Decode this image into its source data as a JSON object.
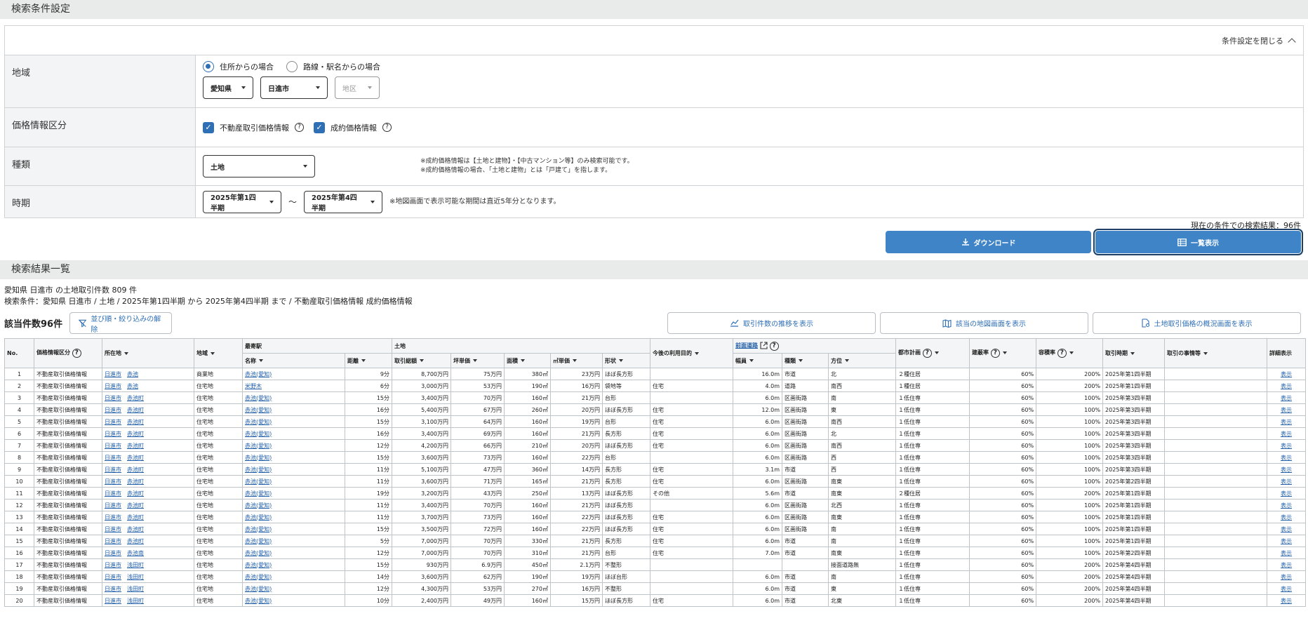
{
  "search_section": {
    "title": "検索条件設定",
    "toggle_label": "条件設定を閉じる"
  },
  "area": {
    "label": "地域",
    "radio_address": "住所からの場合",
    "radio_station": "路線・駅名からの場合",
    "prefecture": "愛知県",
    "city": "日進市",
    "district_placeholder": "地区"
  },
  "price_type": {
    "label": "価格情報区分",
    "opt1": "不動産取引価格情報",
    "opt2": "成約価格情報"
  },
  "kind": {
    "label": "種類",
    "value": "土地",
    "note1": "※成約価格情報は【土地と建物】・【中古マンション等】のみ検索可能です。",
    "note2": "※成約価格情報の場合、「土地と建物」とは「戸建て」を指します。"
  },
  "period": {
    "label": "時期",
    "from": "2025年第1四半期",
    "to": "2025年第4四半期",
    "tilde": "～",
    "note": "※地図画面で表示可能な期間は直近5年分となります。"
  },
  "result_count_text": "現在の条件での検索結果：96件",
  "buttons": {
    "download": "ダウンロード",
    "list": "一覧表示"
  },
  "list_section": {
    "title": "検索結果一覧"
  },
  "summary": {
    "line1": "愛知県 日進市 の土地取引件数 809 件",
    "line2": "検索条件：愛知県 日進市 / 土地 / 2025年第1四半期 から 2025年第4四半期 まで / 不動産取引価格情報 成約価格情報"
  },
  "tools": {
    "count": "該当件数96件",
    "reset": "並び順・絞り込みの解除",
    "trend": "取引件数の推移を表示",
    "map": "該当の地図画面を表示",
    "overview": "土地取引価格の概況画面を表示"
  },
  "table": {
    "h_no": "No.",
    "h_type": "価格情報区分",
    "h_loc": "所在地",
    "h_area": "地域",
    "h_station": "最寄駅",
    "h_st_name": "名称",
    "h_st_dist": "距離",
    "h_land": "土地",
    "h_total": "取引総額",
    "h_tsubo": "坪単価",
    "h_size": "面積",
    "h_m2": "㎡単価",
    "h_shape": "形状",
    "h_purpose": "今後の利用目的",
    "h_road": "前面道路",
    "h_width": "幅員",
    "h_road_kind": "種類",
    "h_dir": "方位",
    "h_plan": "都市計画",
    "h_bcr": "建蔽率",
    "h_far": "容積率",
    "h_time": "取引時期",
    "h_circ": "取引の事情等",
    "h_detail": "詳細表示",
    "rows": [
      {
        "no": "1",
        "type": "不動産取引価格情報",
        "city": "日進市",
        "town": "赤池",
        "area": "商業地",
        "st": "赤池(愛知)",
        "dist": "9分",
        "total": "8,700万円",
        "tsubo": "75万円",
        "size": "380㎡",
        "m2": "23万円",
        "shape": "ほぼ長方形",
        "purpose": "",
        "width": "16.0m",
        "rkind": "市道",
        "dir": "北",
        "plan": "２種住居",
        "bcr": "60%",
        "far": "200%",
        "time": "2025年第1四半期",
        "circ": "",
        "detail": "表示"
      },
      {
        "no": "2",
        "type": "不動産取引価格情報",
        "city": "日進市",
        "town": "赤池",
        "area": "住宅地",
        "st": "米野木",
        "dist": "6分",
        "total": "3,000万円",
        "tsubo": "53万円",
        "size": "190㎡",
        "m2": "16万円",
        "shape": "袋地等",
        "purpose": "住宅",
        "width": "4.0m",
        "rkind": "道路",
        "dir": "南西",
        "plan": "１種住居",
        "bcr": "60%",
        "far": "200%",
        "time": "2025年第1四半期",
        "circ": "",
        "detail": "表示"
      },
      {
        "no": "3",
        "type": "不動産取引価格情報",
        "city": "日進市",
        "town": "赤池町",
        "area": "住宅地",
        "st": "赤池(愛知)",
        "dist": "15分",
        "total": "3,400万円",
        "tsubo": "70万円",
        "size": "160㎡",
        "m2": "21万円",
        "shape": "台形",
        "purpose": "",
        "width": "6.0m",
        "rkind": "区画街路",
        "dir": "南",
        "plan": "１低住専",
        "bcr": "60%",
        "far": "100%",
        "time": "2025年第3四半期",
        "circ": "",
        "detail": "表示"
      },
      {
        "no": "4",
        "type": "不動産取引価格情報",
        "city": "日進市",
        "town": "赤池町",
        "area": "住宅地",
        "st": "赤池(愛知)",
        "dist": "16分",
        "total": "5,400万円",
        "tsubo": "67万円",
        "size": "260㎡",
        "m2": "20万円",
        "shape": "ほぼ長方形",
        "purpose": "住宅",
        "width": "12.0m",
        "rkind": "区画街路",
        "dir": "東",
        "plan": "１低住専",
        "bcr": "60%",
        "far": "100%",
        "time": "2025年第3四半期",
        "circ": "",
        "detail": "表示"
      },
      {
        "no": "5",
        "type": "不動産取引価格情報",
        "city": "日進市",
        "town": "赤池町",
        "area": "住宅地",
        "st": "赤池(愛知)",
        "dist": "15分",
        "total": "3,100万円",
        "tsubo": "64万円",
        "size": "160㎡",
        "m2": "19万円",
        "shape": "台形",
        "purpose": "住宅",
        "width": "6.0m",
        "rkind": "区画街路",
        "dir": "南西",
        "plan": "１低住専",
        "bcr": "60%",
        "far": "100%",
        "time": "2025年第3四半期",
        "circ": "",
        "detail": "表示"
      },
      {
        "no": "6",
        "type": "不動産取引価格情報",
        "city": "日進市",
        "town": "赤池町",
        "area": "住宅地",
        "st": "赤池(愛知)",
        "dist": "16分",
        "total": "3,400万円",
        "tsubo": "69万円",
        "size": "160㎡",
        "m2": "21万円",
        "shape": "長方形",
        "purpose": "住宅",
        "width": "6.0m",
        "rkind": "区画街路",
        "dir": "北",
        "plan": "１低住専",
        "bcr": "60%",
        "far": "100%",
        "time": "2025年第3四半期",
        "circ": "",
        "detail": "表示"
      },
      {
        "no": "7",
        "type": "不動産取引価格情報",
        "city": "日進市",
        "town": "赤池町",
        "area": "住宅地",
        "st": "赤池(愛知)",
        "dist": "12分",
        "total": "4,200万円",
        "tsubo": "66万円",
        "size": "210㎡",
        "m2": "20万円",
        "shape": "ほぼ長方形",
        "purpose": "住宅",
        "width": "6.0m",
        "rkind": "区画街路",
        "dir": "南西",
        "plan": "１低住専",
        "bcr": "60%",
        "far": "100%",
        "time": "2025年第3四半期",
        "circ": "",
        "detail": "表示"
      },
      {
        "no": "8",
        "type": "不動産取引価格情報",
        "city": "日進市",
        "town": "赤池町",
        "area": "住宅地",
        "st": "赤池(愛知)",
        "dist": "15分",
        "total": "3,600万円",
        "tsubo": "73万円",
        "size": "160㎡",
        "m2": "22万円",
        "shape": "台形",
        "purpose": "",
        "width": "6.0m",
        "rkind": "区画街路",
        "dir": "西",
        "plan": "１低住専",
        "bcr": "60%",
        "far": "100%",
        "time": "2025年第3四半期",
        "circ": "",
        "detail": "表示"
      },
      {
        "no": "9",
        "type": "不動産取引価格情報",
        "city": "日進市",
        "town": "赤池町",
        "area": "住宅地",
        "st": "赤池(愛知)",
        "dist": "11分",
        "total": "5,100万円",
        "tsubo": "47万円",
        "size": "360㎡",
        "m2": "14万円",
        "shape": "長方形",
        "purpose": "住宅",
        "width": "3.1m",
        "rkind": "市道",
        "dir": "西",
        "plan": "１低住専",
        "bcr": "60%",
        "far": "100%",
        "time": "2025年第3四半期",
        "circ": "",
        "detail": "表示"
      },
      {
        "no": "10",
        "type": "不動産取引価格情報",
        "city": "日進市",
        "town": "赤池町",
        "area": "住宅地",
        "st": "赤池(愛知)",
        "dist": "11分",
        "total": "3,600万円",
        "tsubo": "71万円",
        "size": "165㎡",
        "m2": "21万円",
        "shape": "長方形",
        "purpose": "住宅",
        "width": "6.0m",
        "rkind": "区画街路",
        "dir": "南東",
        "plan": "１低住専",
        "bcr": "60%",
        "far": "100%",
        "time": "2025年第2四半期",
        "circ": "",
        "detail": "表示"
      },
      {
        "no": "11",
        "type": "不動産取引価格情報",
        "city": "日進市",
        "town": "赤池町",
        "area": "住宅地",
        "st": "赤池(愛知)",
        "dist": "19分",
        "total": "3,200万円",
        "tsubo": "43万円",
        "size": "250㎡",
        "m2": "13万円",
        "shape": "ほぼ長方形",
        "purpose": "その他",
        "width": "5.6m",
        "rkind": "市道",
        "dir": "南東",
        "plan": "２種住居",
        "bcr": "60%",
        "far": "200%",
        "time": "2025年第1四半期",
        "circ": "",
        "detail": "表示"
      },
      {
        "no": "12",
        "type": "不動産取引価格情報",
        "city": "日進市",
        "town": "赤池町",
        "area": "住宅地",
        "st": "赤池(愛知)",
        "dist": "11分",
        "total": "3,400万円",
        "tsubo": "70万円",
        "size": "160㎡",
        "m2": "21万円",
        "shape": "ほぼ長方形",
        "purpose": "",
        "width": "6.0m",
        "rkind": "区画街路",
        "dir": "北西",
        "plan": "１低住専",
        "bcr": "60%",
        "far": "100%",
        "time": "2025年第1四半期",
        "circ": "",
        "detail": "表示"
      },
      {
        "no": "13",
        "type": "不動産取引価格情報",
        "city": "日進市",
        "town": "赤池町",
        "area": "住宅地",
        "st": "赤池(愛知)",
        "dist": "11分",
        "total": "3,700万円",
        "tsubo": "73万円",
        "size": "160㎡",
        "m2": "22万円",
        "shape": "ほぼ長方形",
        "purpose": "住宅",
        "width": "6.0m",
        "rkind": "区画街路",
        "dir": "南東",
        "plan": "１低住専",
        "bcr": "60%",
        "far": "100%",
        "time": "2025年第1四半期",
        "circ": "",
        "detail": "表示"
      },
      {
        "no": "14",
        "type": "不動産取引価格情報",
        "city": "日進市",
        "town": "赤池町",
        "area": "住宅地",
        "st": "赤池(愛知)",
        "dist": "15分",
        "total": "3,500万円",
        "tsubo": "72万円",
        "size": "160㎡",
        "m2": "22万円",
        "shape": "ほぼ長方形",
        "purpose": "住宅",
        "width": "6.0m",
        "rkind": "区画街路",
        "dir": "南",
        "plan": "１低住専",
        "bcr": "60%",
        "far": "100%",
        "time": "2025年第1四半期",
        "circ": "",
        "detail": "表示"
      },
      {
        "no": "15",
        "type": "不動産取引価格情報",
        "city": "日進市",
        "town": "赤池町",
        "area": "住宅地",
        "st": "赤池(愛知)",
        "dist": "5分",
        "total": "7,000万円",
        "tsubo": "70万円",
        "size": "330㎡",
        "m2": "21万円",
        "shape": "長方形",
        "purpose": "住宅",
        "width": "6.0m",
        "rkind": "市道",
        "dir": "南",
        "plan": "１低住専",
        "bcr": "60%",
        "far": "100%",
        "time": "2025年第1四半期",
        "circ": "",
        "detail": "表示"
      },
      {
        "no": "16",
        "type": "不動産取引価格情報",
        "city": "日進市",
        "town": "赤池南",
        "area": "住宅地",
        "st": "赤池(愛知)",
        "dist": "12分",
        "total": "7,000万円",
        "tsubo": "70万円",
        "size": "310㎡",
        "m2": "21万円",
        "shape": "台形",
        "purpose": "住宅",
        "width": "7.0m",
        "rkind": "市道",
        "dir": "南東",
        "plan": "１低住専",
        "bcr": "60%",
        "far": "100%",
        "time": "2025年第2四半期",
        "circ": "",
        "detail": "表示"
      },
      {
        "no": "17",
        "type": "不動産取引価格情報",
        "city": "日進市",
        "town": "浅田町",
        "area": "住宅地",
        "st": "赤池(愛知)",
        "dist": "15分",
        "total": "930万円",
        "tsubo": "6.9万円",
        "size": "450㎡",
        "m2": "2.1万円",
        "shape": "不整形",
        "purpose": "",
        "width": "",
        "rkind": "",
        "dir": "接面道路無",
        "plan": "１低住専",
        "bcr": "60%",
        "far": "200%",
        "time": "2025年第4四半期",
        "circ": "",
        "detail": "表示"
      },
      {
        "no": "18",
        "type": "不動産取引価格情報",
        "city": "日進市",
        "town": "浅田町",
        "area": "住宅地",
        "st": "赤池(愛知)",
        "dist": "14分",
        "total": "3,600万円",
        "tsubo": "62万円",
        "size": "190㎡",
        "m2": "19万円",
        "shape": "ほぼ台形",
        "purpose": "",
        "width": "6.0m",
        "rkind": "市道",
        "dir": "南",
        "plan": "１低住専",
        "bcr": "60%",
        "far": "200%",
        "time": "2025年第4四半期",
        "circ": "",
        "detail": "表示"
      },
      {
        "no": "19",
        "type": "不動産取引価格情報",
        "city": "日進市",
        "town": "浅田町",
        "area": "住宅地",
        "st": "赤池(愛知)",
        "dist": "12分",
        "total": "4,300万円",
        "tsubo": "53万円",
        "size": "270㎡",
        "m2": "16万円",
        "shape": "不整形",
        "purpose": "",
        "width": "6.0m",
        "rkind": "市道",
        "dir": "東",
        "plan": "１低住専",
        "bcr": "60%",
        "far": "200%",
        "time": "2025年第4四半期",
        "circ": "",
        "detail": "表示"
      },
      {
        "no": "20",
        "type": "不動産取引価格情報",
        "city": "日進市",
        "town": "浅田町",
        "area": "住宅地",
        "st": "赤池(愛知)",
        "dist": "10分",
        "total": "2,400万円",
        "tsubo": "49万円",
        "size": "160㎡",
        "m2": "15万円",
        "shape": "ほぼ長方形",
        "purpose": "住宅",
        "width": "6.0m",
        "rkind": "市道",
        "dir": "北東",
        "plan": "１低住専",
        "bcr": "60%",
        "far": "200%",
        "time": "2025年第4四半期",
        "circ": "",
        "detail": "表示"
      }
    ]
  },
  "colors": {
    "accent": "#3e84c7",
    "link": "#1f5ea8",
    "section_bg": "#e9eaea"
  }
}
